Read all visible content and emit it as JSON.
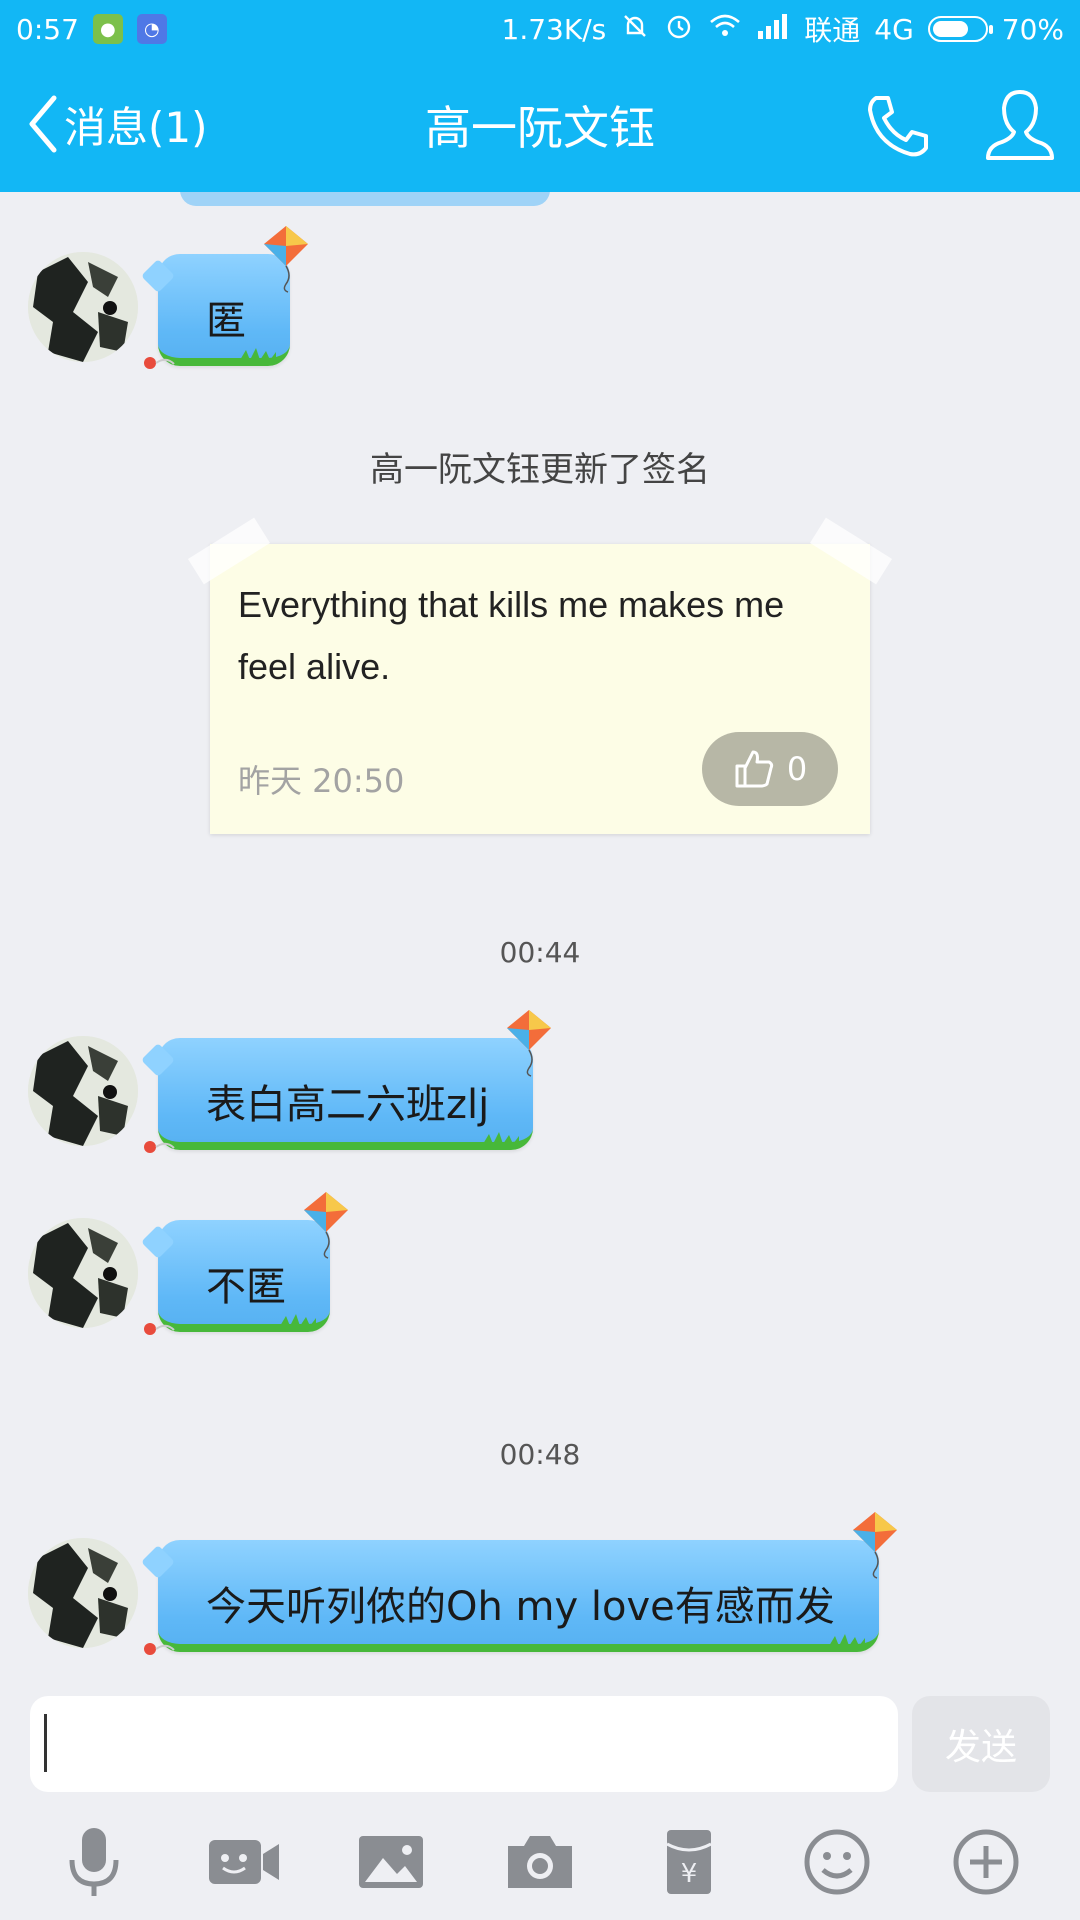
{
  "status_bar": {
    "time": "0:57",
    "speed": "1.73K/s",
    "carrier": "联通",
    "network": "4G",
    "battery": "70%",
    "battery_level": 0.7
  },
  "header": {
    "back_label": "消息(1)",
    "title": "高一阮文钰"
  },
  "messages": {
    "m1": "匿",
    "system_notice": "高一阮文钰更新了签名",
    "signature": {
      "text": "Everything that kills me makes me feel alive.",
      "time": "昨天 20:50",
      "likes": "0"
    },
    "time1": "00:44",
    "m2": "表白高二六班zlj",
    "m3": "不匿",
    "time2": "00:48",
    "m4": "今天听列侬的Oh my love有感而发"
  },
  "input": {
    "value": "",
    "send_label": "发送"
  },
  "colors": {
    "brand": "#12b7f5",
    "bubble": "#6cc0f8",
    "grass": "#47b83a",
    "card": "#fdfde6"
  },
  "toolbar_icons": [
    "microphone-icon",
    "video-icon",
    "image-icon",
    "camera-icon",
    "red-packet-icon",
    "emoji-icon",
    "plus-icon"
  ]
}
